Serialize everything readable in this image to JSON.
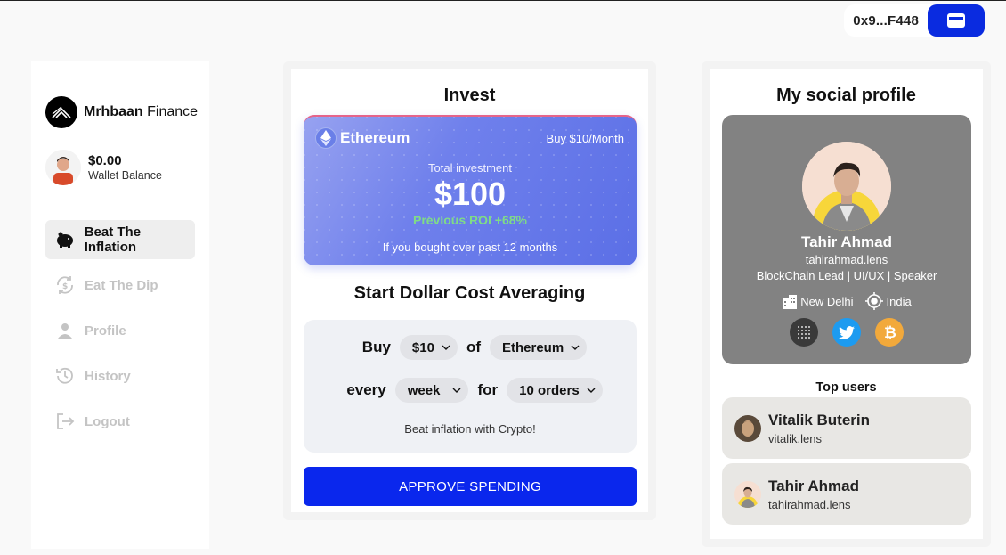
{
  "wallet": {
    "address": "0x9...F448",
    "button_icon": "wallet-icon"
  },
  "brand": {
    "name_bold": "Mrhbaan",
    "name_rest": " Finance"
  },
  "balance": {
    "amount": "$0.00",
    "label": "Wallet Balance"
  },
  "nav": [
    {
      "label": "Beat The Inflation",
      "icon": "piggy-bank-icon",
      "active": true
    },
    {
      "label": "Eat The Dip",
      "icon": "refresh-dollar-icon",
      "active": false
    },
    {
      "label": "Profile",
      "icon": "user-icon",
      "active": false
    },
    {
      "label": "History",
      "icon": "history-icon",
      "active": false
    },
    {
      "label": "Logout",
      "icon": "logout-icon",
      "active": false
    }
  ],
  "invest": {
    "title": "Invest",
    "card": {
      "asset": "Ethereum",
      "buy_rate": "Buy $10/Month",
      "total_label": "Total investment",
      "total_amount": "$100",
      "roi": "Previous ROI +68%",
      "note": "If you bought over past 12 months"
    },
    "dca": {
      "title": "Start Dollar Cost Averaging",
      "word_buy": "Buy",
      "amount": "$10",
      "word_of": "of",
      "asset": "Ethereum",
      "word_every": "every",
      "period": "week",
      "word_for": "for",
      "orders": "10 orders",
      "tagline": "Beat inflation with Crypto!"
    },
    "approve_label": "APPROVE SPENDING"
  },
  "social": {
    "title": "My social profile",
    "name": "Tahir Ahmad",
    "handle": "tahirahmad.lens",
    "bio": "BlockChain Lead | UI/UX | Speaker",
    "city": "New Delhi",
    "country": "India",
    "links": [
      "dots-grid-icon",
      "twitter-icon",
      "bitcoin-icon"
    ],
    "top_users_title": "Top users",
    "top_users": [
      {
        "name": "Vitalik Buterin",
        "handle": "vitalik.lens"
      },
      {
        "name": "Tahir Ahmad",
        "handle": "tahirahmad.lens"
      }
    ]
  },
  "colors": {
    "accent": "#0a27ed",
    "card": "#6f80ec",
    "roi": "#7fdc86",
    "twitter": "#1d9bf0",
    "bitcoin": "#f2a93b"
  }
}
